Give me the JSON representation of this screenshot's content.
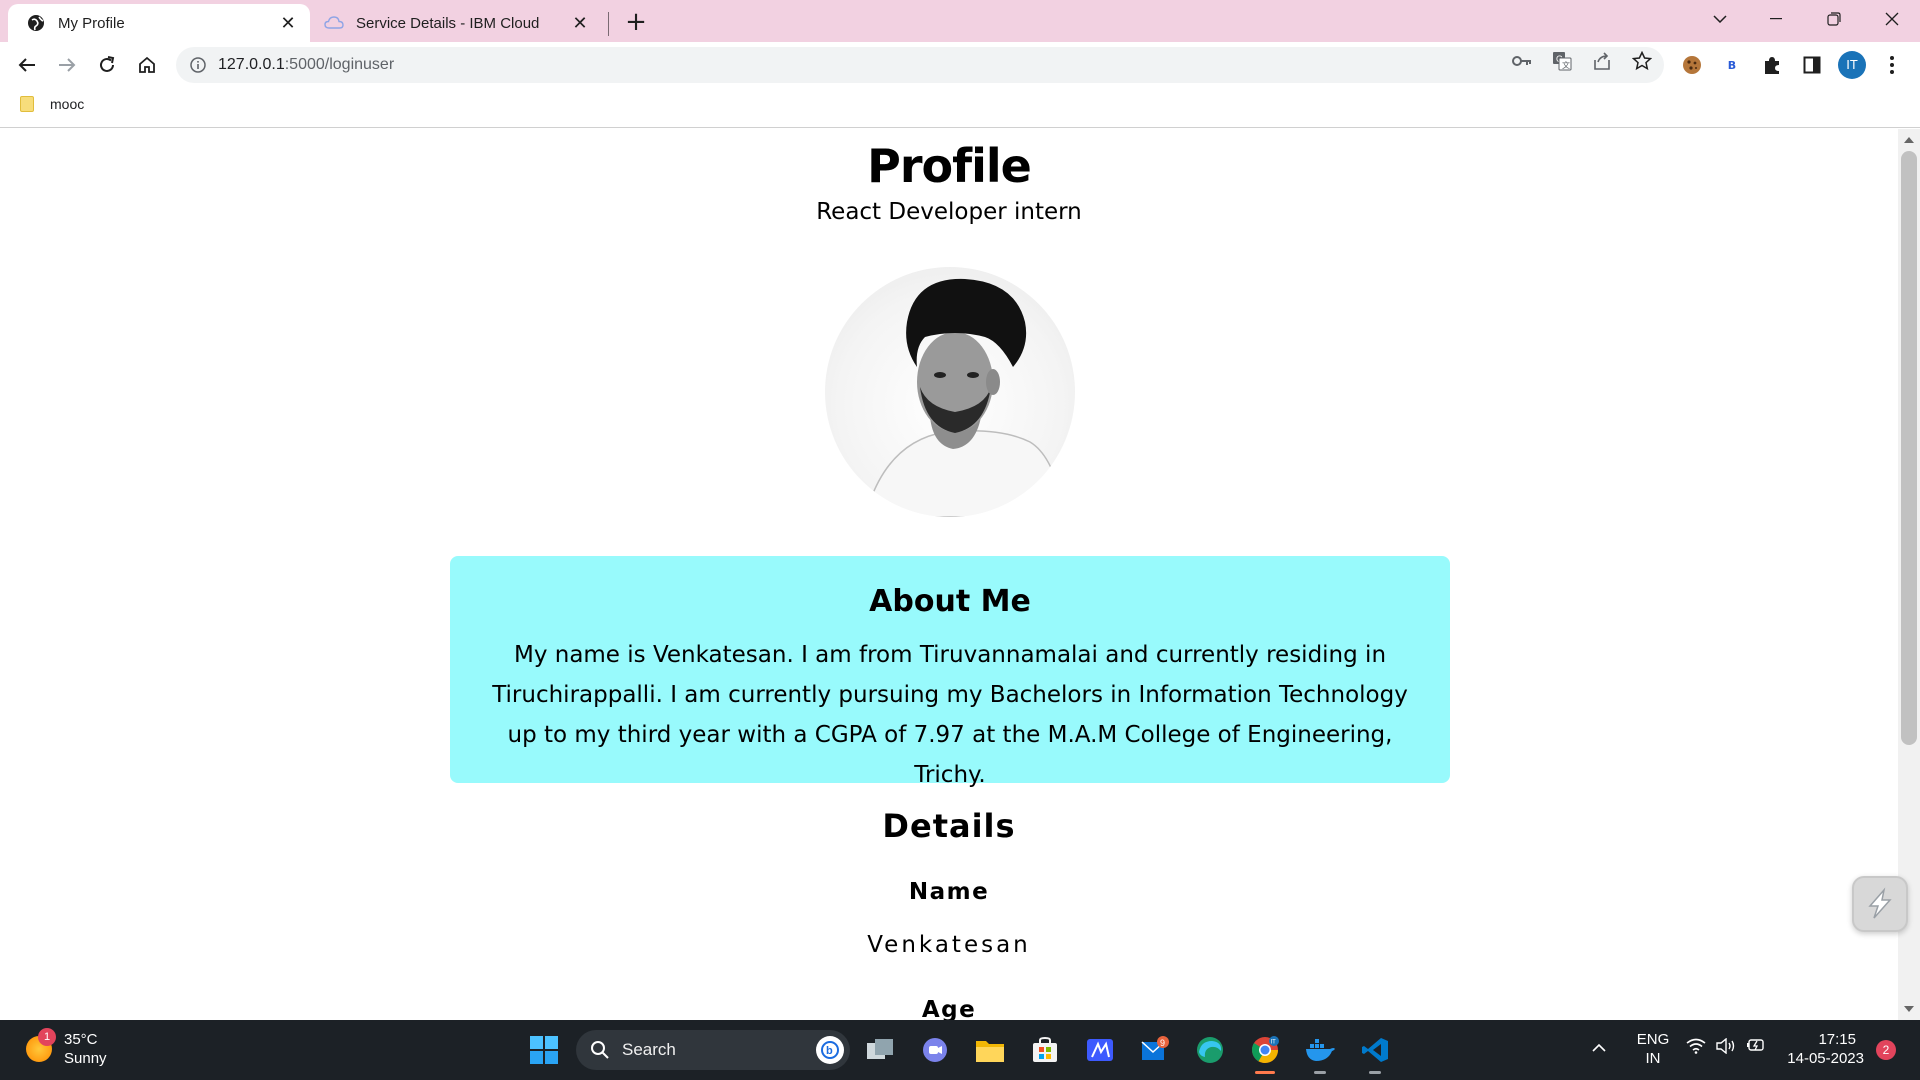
{
  "browser": {
    "tabs": [
      {
        "title": "My Profile",
        "active": true
      },
      {
        "title": "Service Details - IBM Cloud",
        "active": false
      }
    ],
    "new_tab_label": "+",
    "url_host": "127.0.0.1",
    "url_path": ":5000/loginuser",
    "bookmarks": [
      {
        "label": "mooc"
      }
    ],
    "extension_badge": "B",
    "profile_initials": "IT"
  },
  "profile": {
    "title": "Profile",
    "subtitle": "React Developer intern",
    "about_heading": "About Me",
    "about_text": "My name is Venkatesan. I am from Tiruvannamalai and currently residing in Tiruchirappalli.   I am currently pursuing my Bachelors in Information Technology up to my third year with a CGPA of 7.97 at the M.A.M College of Engineering, Trichy.",
    "details_heading": "Details",
    "name_label": "Name",
    "name_value": "Venkatesan",
    "age_label": "Age",
    "about_bg": "#98fafc"
  },
  "taskbar": {
    "weather_temp": "35°C",
    "weather_cond": "Sunny",
    "weather_badge": "1",
    "search_label": "Search",
    "store_badge": "9",
    "lang_top": "ENG",
    "lang_bottom": "IN",
    "time": "17:15",
    "date": "14-05-2023",
    "notification_count": "2"
  }
}
